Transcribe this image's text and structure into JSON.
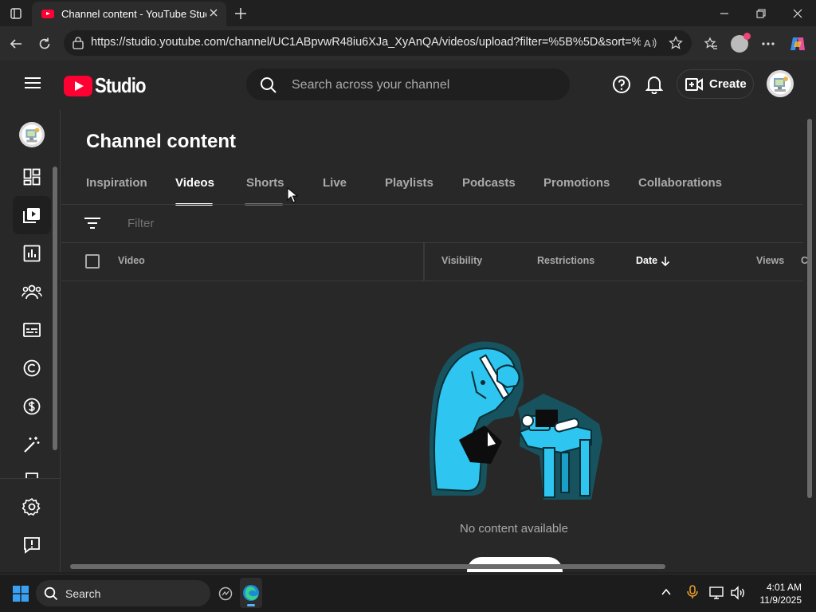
{
  "browser": {
    "tab_title": "Channel content - YouTube Studio",
    "url": "https://studio.youtube.com/channel/UC1ABpvwR48iu6XJa_XyAnQA/videos/upload?filter=%5B%5D&sort=%7..."
  },
  "header": {
    "logo_text": "Studio",
    "search_placeholder": "Search across your channel",
    "create_label": "Create"
  },
  "main": {
    "title": "Channel content",
    "tabs": [
      {
        "label": "Inspiration"
      },
      {
        "label": "Videos"
      },
      {
        "label": "Shorts"
      },
      {
        "label": "Live"
      },
      {
        "label": "Playlists"
      },
      {
        "label": "Podcasts"
      },
      {
        "label": "Promotions"
      },
      {
        "label": "Collaborations"
      }
    ],
    "active_tab": "Videos",
    "filter_placeholder": "Filter",
    "columns": {
      "video": "Video",
      "visibility": "Visibility",
      "restrictions": "Restrictions",
      "date": "Date",
      "views": "Views"
    },
    "empty_message": "No content available"
  },
  "taskbar": {
    "search_label": "Search",
    "time": "4:01 AM",
    "date": "11/9/2025"
  },
  "colors": {
    "yt_red": "#ff0033",
    "bg": "#282828",
    "illustration_cyan": "#2ec5f0"
  }
}
